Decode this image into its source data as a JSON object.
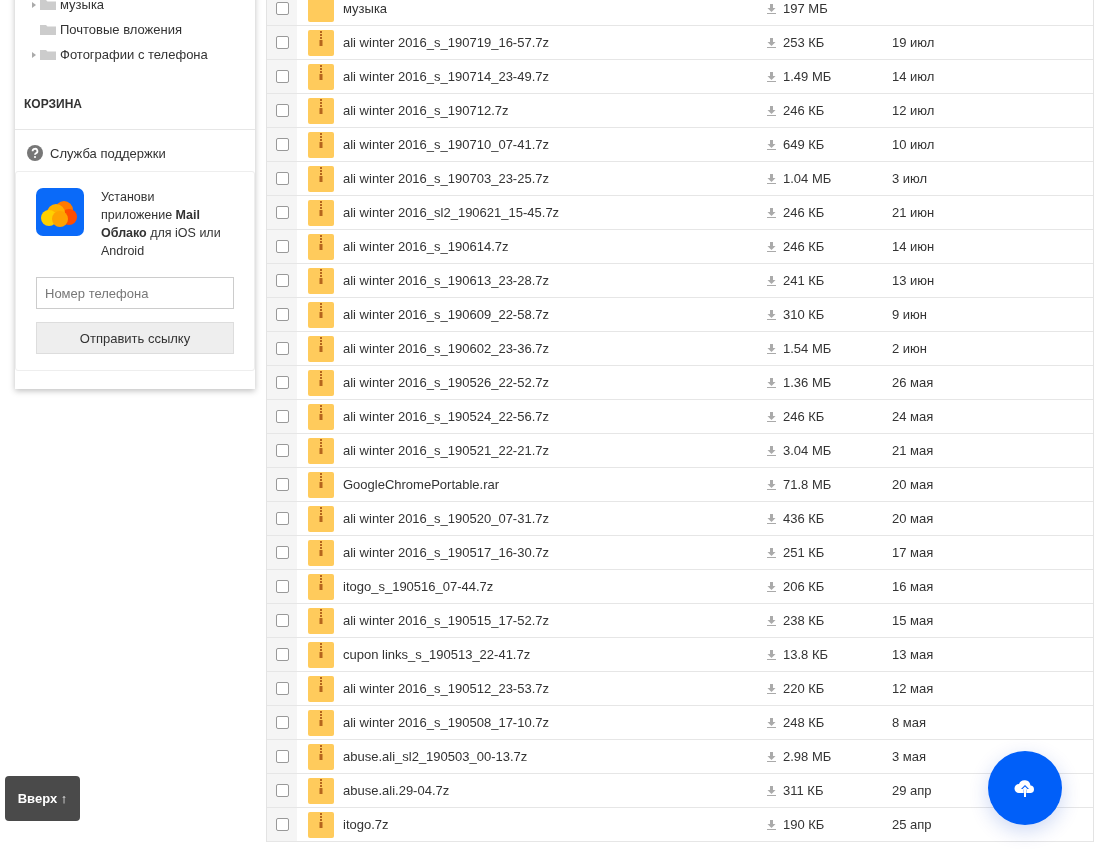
{
  "sidebar": {
    "folders": [
      {
        "label": "музыка",
        "kind": "expandable"
      },
      {
        "label": "Почтовые вложения",
        "kind": "leaf"
      },
      {
        "label": "Фотографии с телефона",
        "kind": "expandable"
      }
    ],
    "trash": "КОРЗИНА",
    "support": "Служба поддержки",
    "promo": {
      "text": "Установи приложение **Mail Облако** для iOS или Android",
      "phone_placeholder": "Номер телефона",
      "button": "Отправить ссылку"
    }
  },
  "files": [
    {
      "kind": "folder",
      "name": "музыка",
      "size": "197 МБ",
      "checked": false
    },
    {
      "kind": "archive",
      "name": "ali winter 2016_s_190719_16-57.7z",
      "size": "253 КБ",
      "date": "19 июл",
      "checked": false
    },
    {
      "kind": "archive",
      "name": "ali winter 2016_s_190714_23-49.7z",
      "size": "1.49 МБ",
      "date": "14 июл",
      "checked": false
    },
    {
      "kind": "archive",
      "name": "ali winter 2016_s_190712.7z",
      "size": "246 КБ",
      "date": "12 июл",
      "checked": false
    },
    {
      "kind": "archive",
      "name": "ali winter 2016_s_190710_07-41.7z",
      "size": "649 КБ",
      "date": "10 июл",
      "checked": false
    },
    {
      "kind": "archive",
      "name": "ali winter 2016_s_190703_23-25.7z",
      "size": "1.04 МБ",
      "date": "3 июл",
      "checked": false
    },
    {
      "kind": "archive",
      "name": "ali winter 2016_sl2_190621_15-45.7z",
      "size": "246 КБ",
      "date": "21 июн",
      "checked": false
    },
    {
      "kind": "archive",
      "name": "ali winter 2016_s_190614.7z",
      "size": "246 КБ",
      "date": "14 июн",
      "checked": false
    },
    {
      "kind": "archive",
      "name": "ali winter 2016_s_190613_23-28.7z",
      "size": "241 КБ",
      "date": "13 июн",
      "checked": false
    },
    {
      "kind": "archive",
      "name": "ali winter 2016_s_190609_22-58.7z",
      "size": "310 КБ",
      "date": "9 июн",
      "checked": false
    },
    {
      "kind": "archive",
      "name": "ali winter 2016_s_190602_23-36.7z",
      "size": "1.54 МБ",
      "date": "2 июн",
      "checked": false
    },
    {
      "kind": "archive",
      "name": "ali winter 2016_s_190526_22-52.7z",
      "size": "1.36 МБ",
      "date": "26 мая",
      "checked": false
    },
    {
      "kind": "archive",
      "name": "ali winter 2016_s_190524_22-56.7z",
      "size": "246 КБ",
      "date": "24 мая",
      "checked": false
    },
    {
      "kind": "archive",
      "name": "ali winter 2016_s_190521_22-21.7z",
      "size": "3.04 МБ",
      "date": "21 мая",
      "checked": false
    },
    {
      "kind": "archive",
      "name": "GoogleChromePortable.rar",
      "size": "71.8 МБ",
      "date": "20 мая",
      "checked": false
    },
    {
      "kind": "archive",
      "name": "ali winter 2016_s_190520_07-31.7z",
      "size": "436 КБ",
      "date": "20 мая",
      "checked": false
    },
    {
      "kind": "archive",
      "name": "ali winter 2016_s_190517_16-30.7z",
      "size": "251 КБ",
      "date": "17 мая",
      "checked": false
    },
    {
      "kind": "archive",
      "name": "itogo_s_190516_07-44.7z",
      "size": "206 КБ",
      "date": "16 мая",
      "checked": false
    },
    {
      "kind": "archive",
      "name": "ali winter 2016_s_190515_17-52.7z",
      "size": "238 КБ",
      "date": "15 мая",
      "checked": false
    },
    {
      "kind": "archive",
      "name": "cupon links_s_190513_22-41.7z",
      "size": "13.8 КБ",
      "date": "13 мая",
      "checked": false
    },
    {
      "kind": "archive",
      "name": "ali winter 2016_s_190512_23-53.7z",
      "size": "220 КБ",
      "date": "12 мая",
      "checked": false
    },
    {
      "kind": "archive",
      "name": "ali winter 2016_s_190508_17-10.7z",
      "size": "248 КБ",
      "date": "8 мая",
      "checked": false
    },
    {
      "kind": "archive",
      "name": "abuse.ali_sl2_190503_00-13.7z",
      "size": "2.98 МБ",
      "date": "3 мая",
      "checked": false
    },
    {
      "kind": "archive",
      "name": "abuse.ali.29-04.7z",
      "size": "311 КБ",
      "date": "29 апр",
      "checked": false
    },
    {
      "kind": "archive",
      "name": "itogo.7z",
      "size": "190 КБ",
      "date": "25 апр",
      "checked": false
    }
  ],
  "scroll_top_button": "Вверх ↑"
}
